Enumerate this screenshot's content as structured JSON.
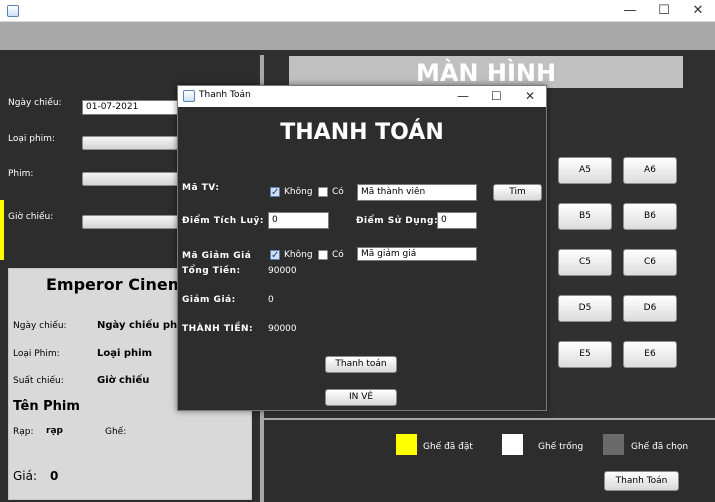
{
  "window": {
    "minimize": "—",
    "maximize": "☐",
    "close": "✕"
  },
  "left_form": {
    "ngay_chieu_label": "Ngày chiếu:",
    "ngay_chieu_value": "01-07-2021",
    "loai_phim_label": "Loại phim:",
    "phim_label": "Phim:",
    "gio_chieu_label": "Giờ chiếu:"
  },
  "info": {
    "cinema_name": "Emperor Cinema",
    "ngay_chieu_label": "Ngày chiếu:",
    "ngay_chieu_value": "Ngày chiếu phim",
    "loai_phim_label": "Loại Phim:",
    "loai_phim_value": "Loại phim",
    "suat_chieu_label": "Suất chiếu:",
    "suat_chieu_value": "Giờ chiếu",
    "ten_phim": "Tên Phim",
    "rap_label": "Rạp:",
    "rap_value": "rạp",
    "ghe_label": "Ghế:",
    "gia_label": "Giá:",
    "gia_value": "0"
  },
  "screen_title": "MÀN HÌNH",
  "seats": [
    "A5",
    "A6",
    "B5",
    "B6",
    "C5",
    "C6",
    "D5",
    "D6",
    "E5",
    "E6"
  ],
  "legend": {
    "booked": "Ghế đã đặt",
    "empty": "Ghế trống",
    "selected": "Ghế đã chọn",
    "colors": {
      "booked": "#ffff00",
      "empty": "#ffffff",
      "selected": "#6a6a6a"
    }
  },
  "main_pay_button": "Thanh Toán",
  "dialog": {
    "title": "Thanh Toán",
    "heading": "THANH TOÁN",
    "ma_tv_label": "Mã TV:",
    "khong_label": "Không",
    "co_label": "Có",
    "ma_tv_placeholder": "Mã thành viên",
    "tim_button": "Tim",
    "diem_tich_luy_label": "Điểm  Tích Luỹ:",
    "diem_tich_luy_value": "0",
    "diem_su_dung_label": "Điểm  Sử Dụng:",
    "diem_su_dung_value": "0",
    "ma_giam_gia_label": "Mã Giảm Giá",
    "khong2_label": "Không",
    "co2_label": "Có",
    "ma_giam_gia_placeholder": "Mã giảm giá",
    "tong_tien_label": "Tổng Tiền:",
    "tong_tien_value": "90000",
    "giam_gia_label": "Giảm Giá:",
    "giam_gia_value": "0",
    "thanh_tien_label": "THÀNH TIỀN:",
    "thanh_tien_value": "90000",
    "thanh_toan_button": "Thanh toán",
    "in_ve_button": "IN VÉ"
  }
}
